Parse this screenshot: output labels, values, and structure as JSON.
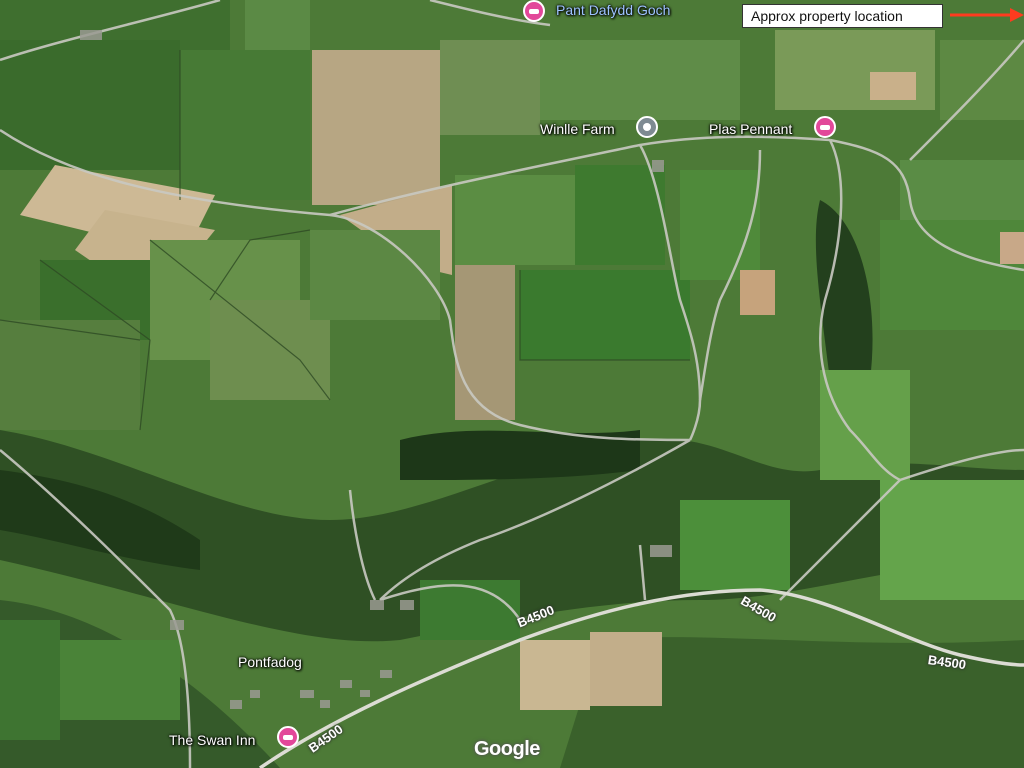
{
  "map": {
    "callout": {
      "text": "Approx property location",
      "arrow_color": "#ff3b1f"
    },
    "places": [
      {
        "name": "Pant Dafydd Goch",
        "pin": "pink",
        "color": "#e2489a"
      },
      {
        "name": "Winlle Farm",
        "pin": "grey",
        "color": "#7e8a92"
      },
      {
        "name": "Plas Pennant",
        "pin": "pink",
        "color": "#e2489a"
      },
      {
        "name": "Pontfadog",
        "pin": "none"
      },
      {
        "name": "The Swan Inn",
        "pin": "pink",
        "color": "#e2489a"
      }
    ],
    "roads": [
      "B4500",
      "B4500",
      "B4500",
      "B4500"
    ],
    "attribution": "Google"
  }
}
